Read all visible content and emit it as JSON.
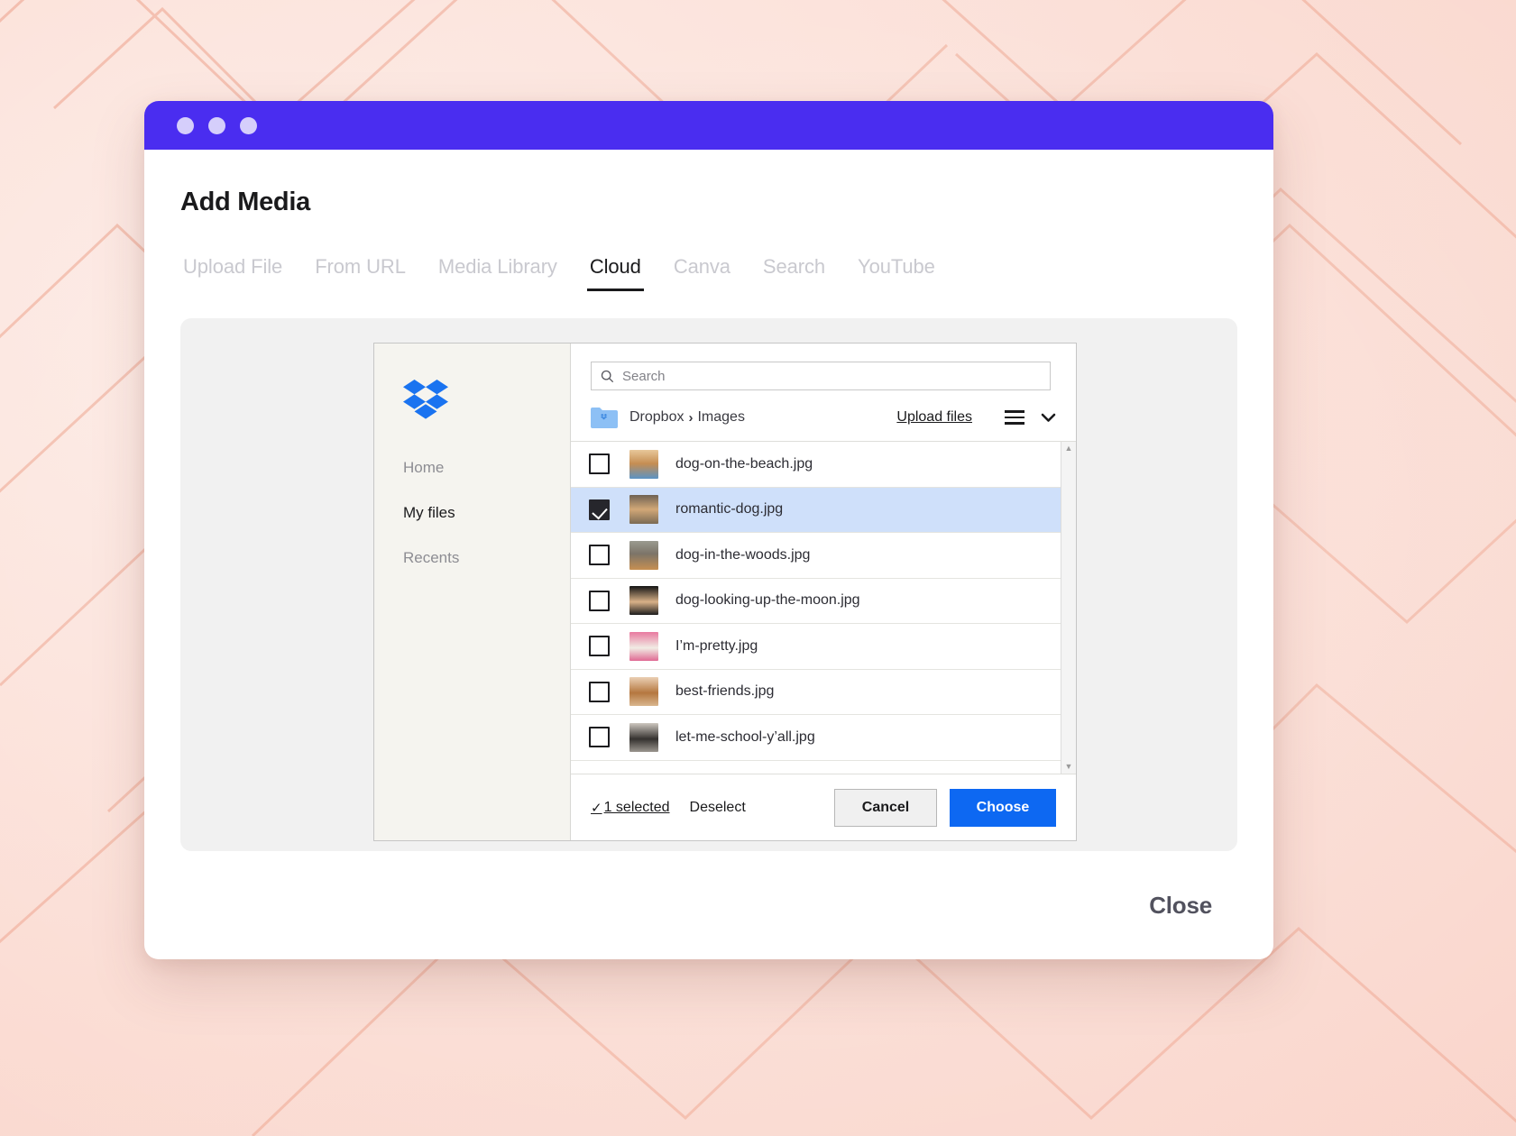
{
  "window": {
    "titlebar_dots": 3,
    "accent_titlebar": "#4a2df0",
    "dot_color": "#d5cefb"
  },
  "header": {
    "title": "Add Media"
  },
  "tabs": [
    {
      "label": "Upload File",
      "active": false
    },
    {
      "label": "From URL",
      "active": false
    },
    {
      "label": "Media Library",
      "active": false
    },
    {
      "label": "Cloud",
      "active": true
    },
    {
      "label": "Canva",
      "active": false
    },
    {
      "label": "Search",
      "active": false
    },
    {
      "label": "YouTube",
      "active": false
    }
  ],
  "chooser": {
    "provider": "dropbox",
    "sidebar": {
      "logo": "dropbox-logo",
      "items": [
        {
          "label": "Home",
          "active": false
        },
        {
          "label": "My files",
          "active": true
        },
        {
          "label": "Recents",
          "active": false
        }
      ]
    },
    "search": {
      "icon": "search-icon",
      "placeholder": "Search",
      "value": ""
    },
    "breadcrumb": {
      "folder_icon": "folder-icon",
      "root": "Dropbox",
      "separator": "›",
      "current": "Images"
    },
    "upload_link": "Upload files",
    "view_toggle": {
      "list_icon": "list-view-icon",
      "chevron_icon": "chevron-down-icon"
    },
    "files": [
      {
        "name": "dog-on-the-beach.jpg",
        "selected": false,
        "thumb_colors": [
          "#e8c89a",
          "#b2763f",
          "#5b93c4"
        ]
      },
      {
        "name": "romantic-dog.jpg",
        "selected": true,
        "thumb_colors": [
          "#9a8166",
          "#d8ab74",
          "#6d5a46"
        ]
      },
      {
        "name": "dog-in-the-woods.jpg",
        "selected": false,
        "thumb_colors": [
          "#8e8e86",
          "#c68f52",
          "#4d4a44"
        ]
      },
      {
        "name": "dog-looking-up-the-moon.jpg",
        "selected": false,
        "thumb_colors": [
          "#1a1a1a",
          "#d9b188",
          "#2b2b2b"
        ]
      },
      {
        "name": "I’m-pretty.jpg",
        "selected": false,
        "thumb_colors": [
          "#e8799f",
          "#f3f0ea",
          "#e06a93"
        ]
      },
      {
        "name": "best-friends.jpg",
        "selected": false,
        "thumb_colors": [
          "#e3c5a4",
          "#b5773f",
          "#d9b68e"
        ]
      },
      {
        "name": "let-me-school-y’all.jpg",
        "selected": false,
        "thumb_colors": [
          "#c9c3bb",
          "#35322f",
          "#8e8a84"
        ]
      }
    ],
    "scrollbar": {
      "up_arrow": "▲",
      "down_arrow": "▼"
    },
    "footer": {
      "selected_tick": "✓",
      "selected_label": "1 selected",
      "deselect_label": "Deselect",
      "cancel_label": "Cancel",
      "choose_label": "Choose",
      "choose_color": "#0d68f2"
    }
  },
  "footer": {
    "close_label": "Close"
  }
}
